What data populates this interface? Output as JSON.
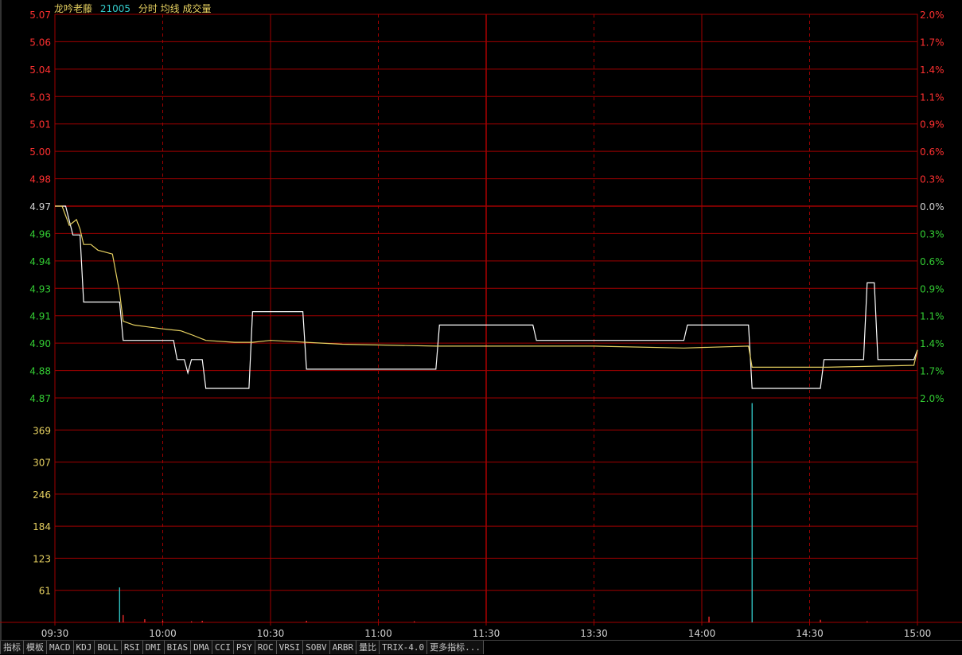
{
  "header": {
    "stock_name": "龙吟老藤",
    "code": "21005",
    "indicators": "分时 均线 成交量"
  },
  "colors": {
    "grid": "#a00000",
    "price_line": "#ffffff",
    "avg_line": "#e6d060",
    "up": "#ff3030",
    "down": "#33cc33",
    "neutral": "#d0d0d0",
    "volume_up": "#ff3030",
    "volume_down": "#33cccc",
    "volume_label": "#e6d060"
  },
  "chart_data": {
    "type": "line",
    "prev_close": 4.97,
    "ylim": [
      4.87,
      5.07
    ],
    "price_ticks": [
      "5.07",
      "5.06",
      "5.04",
      "5.03",
      "5.01",
      "5.00",
      "4.98",
      "4.97",
      "4.96",
      "4.94",
      "4.93",
      "4.91",
      "4.90",
      "4.88",
      "4.87"
    ],
    "pct_ticks": [
      "2.0%",
      "1.7%",
      "1.4%",
      "1.1%",
      "0.9%",
      "0.6%",
      "0.3%",
      "0.0%",
      "0.3%",
      "0.6%",
      "0.9%",
      "1.1%",
      "1.4%",
      "1.7%",
      "2.0%"
    ],
    "volume_ticks": [
      "369",
      "307",
      "246",
      "184",
      "123",
      "61"
    ],
    "volume_ylim": [
      0,
      430
    ],
    "time_labels": [
      "09:30",
      "10:00",
      "10:30",
      "11:00",
      "11:30",
      "13:30",
      "14:00",
      "14:30",
      "15:00"
    ],
    "total_minutes": 240,
    "series": [
      {
        "key": "price",
        "points": [
          [
            0,
            4.97
          ],
          [
            3,
            4.97
          ],
          [
            5,
            4.955
          ],
          [
            7,
            4.955
          ],
          [
            8,
            4.92
          ],
          [
            18,
            4.92
          ],
          [
            19,
            4.9
          ],
          [
            33,
            4.9
          ],
          [
            34,
            4.89
          ],
          [
            36,
            4.89
          ],
          [
            37,
            4.883
          ],
          [
            38,
            4.89
          ],
          [
            41,
            4.89
          ],
          [
            42,
            4.875
          ],
          [
            54,
            4.875
          ],
          [
            55,
            4.915
          ],
          [
            69,
            4.915
          ],
          [
            70,
            4.885
          ],
          [
            106,
            4.885
          ],
          [
            107,
            4.908
          ],
          [
            133,
            4.908
          ],
          [
            134,
            4.9
          ],
          [
            175,
            4.9
          ],
          [
            176,
            4.908
          ],
          [
            193,
            4.908
          ],
          [
            194,
            4.875
          ],
          [
            213,
            4.875
          ],
          [
            214,
            4.89
          ],
          [
            225,
            4.89
          ],
          [
            226,
            4.93
          ],
          [
            228,
            4.93
          ],
          [
            229,
            4.89
          ],
          [
            239,
            4.89
          ],
          [
            240,
            4.895
          ]
        ]
      },
      {
        "key": "average",
        "points": [
          [
            0,
            4.97
          ],
          [
            2,
            4.97
          ],
          [
            4,
            4.96
          ],
          [
            6,
            4.963
          ],
          [
            7,
            4.958
          ],
          [
            8,
            4.95
          ],
          [
            10,
            4.95
          ],
          [
            12,
            4.947
          ],
          [
            16,
            4.945
          ],
          [
            17,
            4.935
          ],
          [
            18,
            4.925
          ],
          [
            19,
            4.91
          ],
          [
            22,
            4.908
          ],
          [
            26,
            4.907
          ],
          [
            30,
            4.906
          ],
          [
            35,
            4.905
          ],
          [
            38,
            4.903
          ],
          [
            42,
            4.9
          ],
          [
            50,
            4.899
          ],
          [
            55,
            4.899
          ],
          [
            60,
            4.9
          ],
          [
            70,
            4.899
          ],
          [
            80,
            4.898
          ],
          [
            106,
            4.897
          ],
          [
            150,
            4.897
          ],
          [
            175,
            4.896
          ],
          [
            193,
            4.897
          ],
          [
            194,
            4.886
          ],
          [
            200,
            4.886
          ],
          [
            215,
            4.886
          ],
          [
            239,
            4.887
          ],
          [
            240,
            4.895
          ]
        ]
      }
    ],
    "volume": [
      {
        "t": 18,
        "v": 67,
        "dir": "down"
      },
      {
        "t": 19,
        "v": 14,
        "dir": "up"
      },
      {
        "t": 25,
        "v": 6,
        "dir": "up"
      },
      {
        "t": 30,
        "v": 3,
        "dir": "up"
      },
      {
        "t": 38,
        "v": 2,
        "dir": "up"
      },
      {
        "t": 41,
        "v": 3,
        "dir": "up"
      },
      {
        "t": 70,
        "v": 3,
        "dir": "up"
      },
      {
        "t": 100,
        "v": 2,
        "dir": "up"
      },
      {
        "t": 182,
        "v": 11,
        "dir": "up"
      },
      {
        "t": 194,
        "v": 420,
        "dir": "down"
      },
      {
        "t": 213,
        "v": 5,
        "dir": "up"
      },
      {
        "t": 226,
        "v": 2,
        "dir": "up"
      }
    ]
  },
  "tabs": [
    "指标",
    "模板",
    "MACD",
    "KDJ",
    "BOLL",
    "RSI",
    "DMI",
    "BIAS",
    "DMA",
    "CCI",
    "PSY",
    "ROC",
    "VRSI",
    "SOBV",
    "ARBR",
    "量比",
    "TRIX-4.0",
    "更多指标..."
  ]
}
